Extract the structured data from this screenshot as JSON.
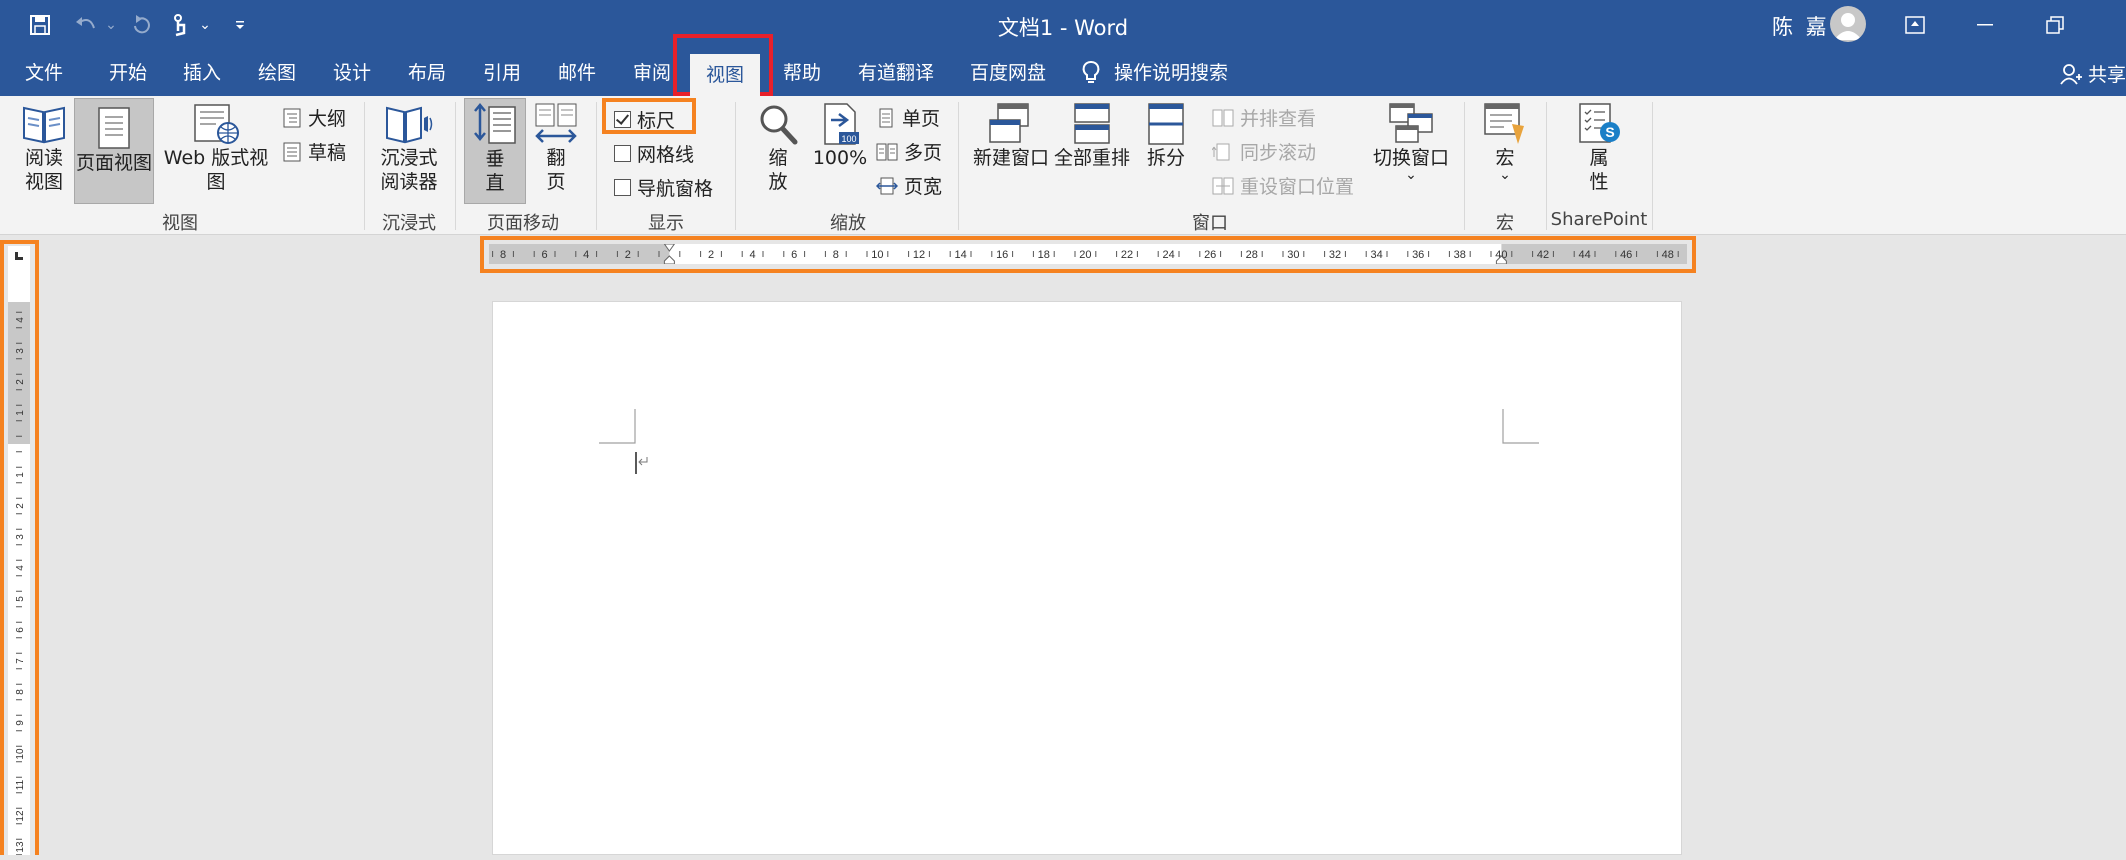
{
  "titlebar": {
    "doc_title": "文档1  -  Word",
    "user_name": "陈 嘉"
  },
  "tabs": [
    {
      "label": "文件"
    },
    {
      "label": "开始"
    },
    {
      "label": "插入"
    },
    {
      "label": "绘图"
    },
    {
      "label": "设计"
    },
    {
      "label": "布局"
    },
    {
      "label": "引用"
    },
    {
      "label": "邮件"
    },
    {
      "label": "审阅"
    },
    {
      "label": "视图"
    },
    {
      "label": "帮助"
    },
    {
      "label": "有道翻译"
    },
    {
      "label": "百度网盘"
    },
    {
      "label": "操作说明搜索"
    }
  ],
  "share_label": "共享",
  "ribbon": {
    "views": {
      "read_mode": "阅读\n视图",
      "print_layout": "页面视图",
      "web_layout": "Web 版式视图",
      "outline": "大纲",
      "draft": "草稿",
      "group": "视图"
    },
    "immersive": {
      "reader": "沉浸式\n阅读器",
      "group": "沉浸式"
    },
    "page_movement": {
      "vertical": "垂\n直",
      "side_to_side": "翻\n页",
      "group": "页面移动"
    },
    "show": {
      "ruler": {
        "label": "标尺",
        "checked": true
      },
      "gridlines": {
        "label": "网格线",
        "checked": false
      },
      "nav_pane": {
        "label": "导航窗格",
        "checked": false
      },
      "group": "显示"
    },
    "zoom": {
      "zoom": "缩\n放",
      "percent": "100%",
      "one_page": "单页",
      "multi_page": "多页",
      "page_width": "页宽",
      "group": "缩放"
    },
    "window": {
      "new_window": "新建窗口",
      "arrange_all": "全部重排",
      "split": "拆分",
      "side_by_side": "并排查看",
      "sync_scroll": "同步滚动",
      "reset_position": "重设窗口位置",
      "switch": "切换窗口",
      "group": "窗口"
    },
    "macros": {
      "macros": "宏",
      "group": "宏"
    },
    "sharepoint": {
      "properties": "属\n性",
      "group": "SharePoint"
    }
  },
  "hruler": {
    "labels": [
      "8",
      "6",
      "4",
      "2",
      "",
      "2",
      "4",
      "6",
      "8",
      "10",
      "12",
      "14",
      "16",
      "18",
      "20",
      "22",
      "24",
      "26",
      "28",
      "30",
      "32",
      "34",
      "36",
      "38",
      "40",
      "42",
      "44",
      "46",
      "48"
    ]
  },
  "vruler": {
    "labels": [
      "4",
      "3",
      "2",
      "1",
      "",
      "1",
      "2",
      "3",
      "4",
      "5",
      "6",
      "7",
      "8",
      "9",
      "10",
      "11",
      "12",
      "13"
    ]
  },
  "colors": {
    "brand": "#2b579a",
    "highlight_red": "#e8202a",
    "highlight_orange": "#f58220"
  }
}
